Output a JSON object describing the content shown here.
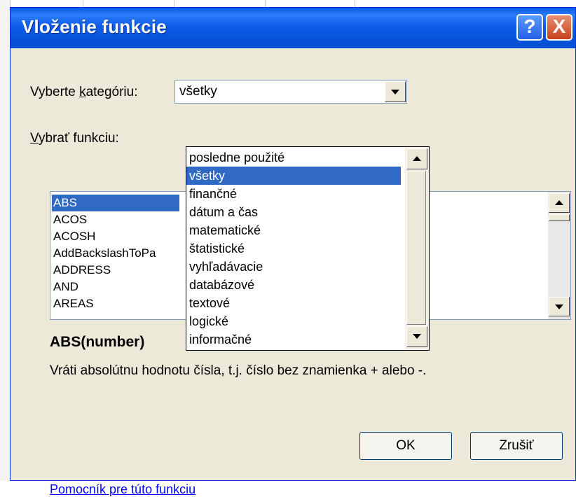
{
  "dialog": {
    "title": "Vloženie funkcie",
    "help_glyph": "?",
    "close_glyph": "X"
  },
  "category": {
    "label": "Vyberte kategóriu:",
    "label_accel": "k",
    "selected": "všetky",
    "options": [
      "posledne použité",
      "všetky",
      "finančné",
      "dátum a čas",
      "matematické",
      "štatistické",
      "vyhľadávacie",
      "databázové",
      "textové",
      "logické",
      "informačné"
    ],
    "selected_index": 1
  },
  "function_list": {
    "label": "Vybrať funkciu:",
    "label_accel": "V",
    "items": [
      "ABS",
      "ACOS",
      "ACOSH",
      "AddBackslashToPa",
      "ADDRESS",
      "AND",
      "AREAS"
    ],
    "selected_index": 0
  },
  "function_info": {
    "signature": "ABS(number)",
    "description": "Vráti absolútnu hodnotu čísla, t.j. číslo bez znamienka + alebo -."
  },
  "help_link": "Pomocník pre túto funkciu",
  "buttons": {
    "ok": "OK",
    "cancel": "Zrušiť"
  },
  "colors": {
    "titlebar": "#0a5be8",
    "selection": "#316ac5",
    "link": "#0000ff",
    "dialog_bg": "#ece9d8"
  }
}
